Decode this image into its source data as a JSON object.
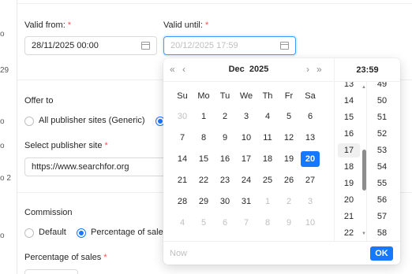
{
  "left_edge": [
    "o",
    "29",
    "o",
    "o",
    "o 2",
    "o"
  ],
  "valid_from": {
    "label": "Valid from:",
    "required": "*",
    "value": "28/11/2025 00:00"
  },
  "valid_until": {
    "label": "Valid until:",
    "required": "*",
    "placeholder": "20/12/2025 17:59"
  },
  "offer_to": {
    "label": "Offer to",
    "options": [
      "All publisher sites (Generic)"
    ]
  },
  "publisher_site": {
    "label": "Select publisher site",
    "required": "*",
    "value": "https://www.searchfor.org"
  },
  "commission": {
    "label": "Commission",
    "options": [
      "Default",
      "Percentage of sale"
    ]
  },
  "percentage": {
    "label": "Percentage of sales",
    "required": "*"
  },
  "picker": {
    "month": "Dec",
    "year": "2025",
    "nav": {
      "super_prev": "«",
      "prev": "‹",
      "next": "›",
      "super_next": "»"
    },
    "weekdays": [
      "Su",
      "Mo",
      "Tu",
      "We",
      "Th",
      "Fr",
      "Sa"
    ],
    "weeks": [
      [
        "30",
        "1",
        "2",
        "3",
        "4",
        "5",
        "6"
      ],
      [
        "7",
        "8",
        "9",
        "10",
        "11",
        "12",
        "13"
      ],
      [
        "14",
        "15",
        "16",
        "17",
        "18",
        "19",
        "20"
      ],
      [
        "21",
        "22",
        "23",
        "24",
        "25",
        "26",
        "27"
      ],
      [
        "28",
        "29",
        "30",
        "31",
        "1",
        "2",
        "3"
      ],
      [
        "4",
        "5",
        "6",
        "7",
        "8",
        "9",
        "10"
      ]
    ],
    "out_of_month": [
      [
        0,
        0
      ],
      [
        4,
        4
      ],
      [
        4,
        5
      ],
      [
        4,
        6
      ],
      [
        5,
        0
      ],
      [
        5,
        1
      ],
      [
        5,
        2
      ],
      [
        5,
        3
      ],
      [
        5,
        4
      ],
      [
        5,
        5
      ],
      [
        5,
        6
      ]
    ],
    "selected": [
      2,
      6
    ],
    "time_header": "23:59",
    "hours": [
      "13",
      "14",
      "15",
      "16",
      "17",
      "18",
      "19",
      "20",
      "21",
      "22"
    ],
    "hours_current": "17",
    "minutes": [
      "49",
      "50",
      "51",
      "52",
      "53",
      "54",
      "55",
      "56",
      "57",
      "58"
    ],
    "now_label": "Now",
    "ok_label": "OK"
  },
  "colors": {
    "primary": "#1677ff",
    "required": "#ff4d4f",
    "border": "#d9d9d9"
  },
  "icons": {
    "date_field": "calendar-icon"
  }
}
